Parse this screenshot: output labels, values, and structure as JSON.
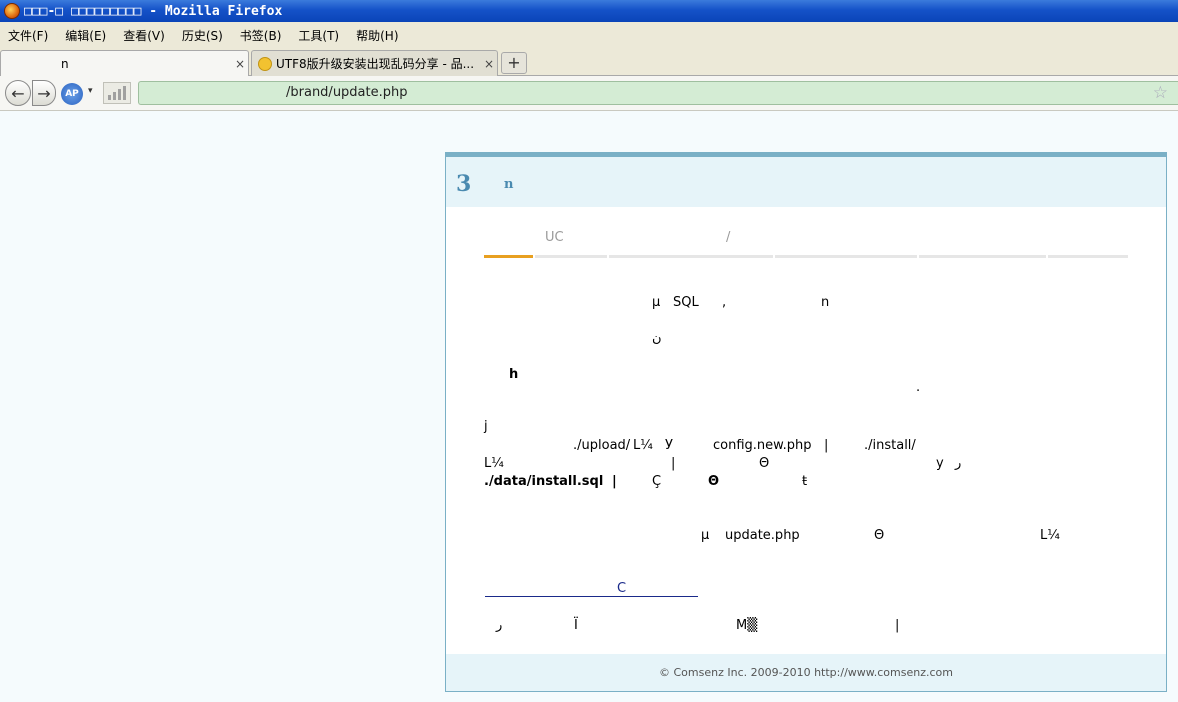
{
  "window": {
    "title": "□□□-□ □□□□□□□□□ - Mozilla Firefox"
  },
  "menu": [
    "文件(F)",
    "编辑(E)",
    "查看(V)",
    "历史(S)",
    "书签(B)",
    "工具(T)",
    "帮助(H)"
  ],
  "tabs": [
    {
      "title": "n",
      "close": "×"
    },
    {
      "title": "UTF8版升级安装出现乱码分享 - 品...",
      "close": "×"
    }
  ],
  "new_tab": "+",
  "nav": {
    "url": "/brand/update.php",
    "home_label": "AP",
    "dropdown": "▾"
  },
  "panel": {
    "step_number": "3",
    "step_title": "n",
    "steps": [
      {
        "label": ""
      },
      {
        "label": "UC"
      },
      {
        "label": "/"
      },
      {
        "label": ""
      },
      {
        "label": ""
      },
      {
        "label": ""
      }
    ],
    "lines": {
      "l1a": "µ",
      "l1b": "SQL",
      "l1c": ",",
      "l1d": "n",
      "l2": "ﻥ",
      "h": "h",
      "dot": "·",
      "j": "j",
      "l5a": "./upload/",
      "l5b": "L¼",
      "l5c": "У",
      "l5d": "config.new.php",
      "l5e": "|",
      "l5f": "./install/",
      "l6a": "L¼",
      "l6b": "|",
      "l6c": "Θ",
      "l6d": "у",
      "l6e": "ر",
      "l7a": "./data/install.sql",
      "l7b": "|",
      "l7c": "Ç",
      "l7d": "Θ",
      "l7e": "ŧ",
      "l8a": "µ",
      "l8b": "update.php",
      "l8c": "Θ",
      "l8d": "L¼",
      "link": "C",
      "l9a": "ر",
      "l9b": "Ï",
      "l9c": "M▒",
      "l9d": "|"
    },
    "footer": "© Comsenz Inc. 2009-2010 http://www.comsenz.com"
  }
}
